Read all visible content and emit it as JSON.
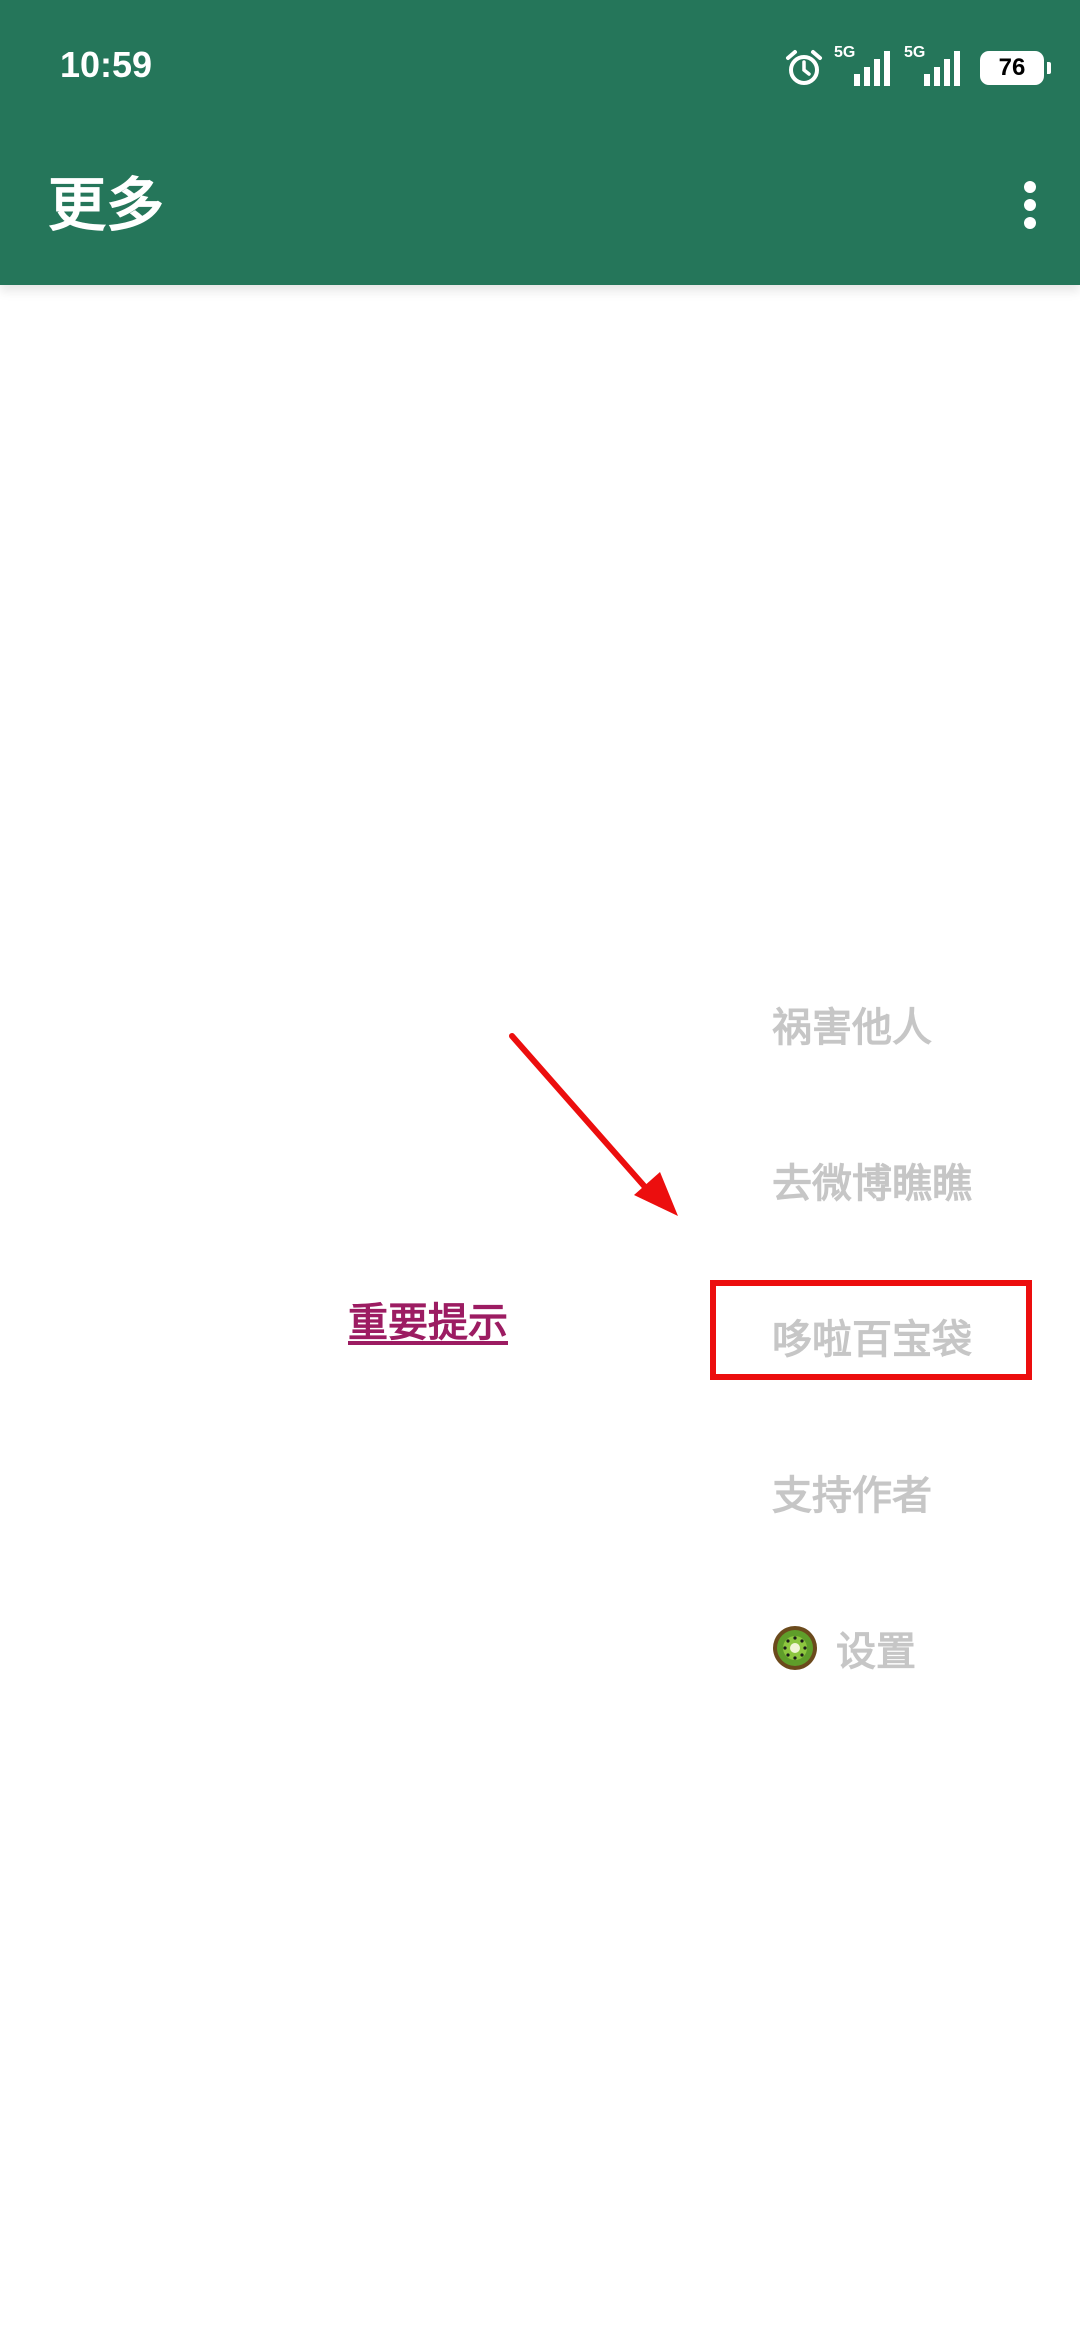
{
  "status_bar": {
    "time": "10:59",
    "network_1": "5G",
    "network_2": "5G",
    "battery": "76",
    "icons": [
      "alarm-icon",
      "signal-icon",
      "signal-icon",
      "battery-icon"
    ]
  },
  "app_bar": {
    "title": "更多",
    "overflow_icon": "more-vert-icon",
    "background_color": "#25765a"
  },
  "menu": {
    "items": [
      {
        "label": "祸害他人"
      },
      {
        "label": "去微博瞧瞧"
      },
      {
        "label": "哆啦百宝袋"
      },
      {
        "label": "支持作者"
      },
      {
        "label": "设置",
        "icon": "kiwi-icon"
      }
    ],
    "text_color": "#c6c6c6"
  },
  "notice": {
    "label": "重要提示",
    "color": "#9c1c62"
  },
  "annotation": {
    "color": "#ec0e0e",
    "highlighted_item": "哆啦百宝袋"
  }
}
